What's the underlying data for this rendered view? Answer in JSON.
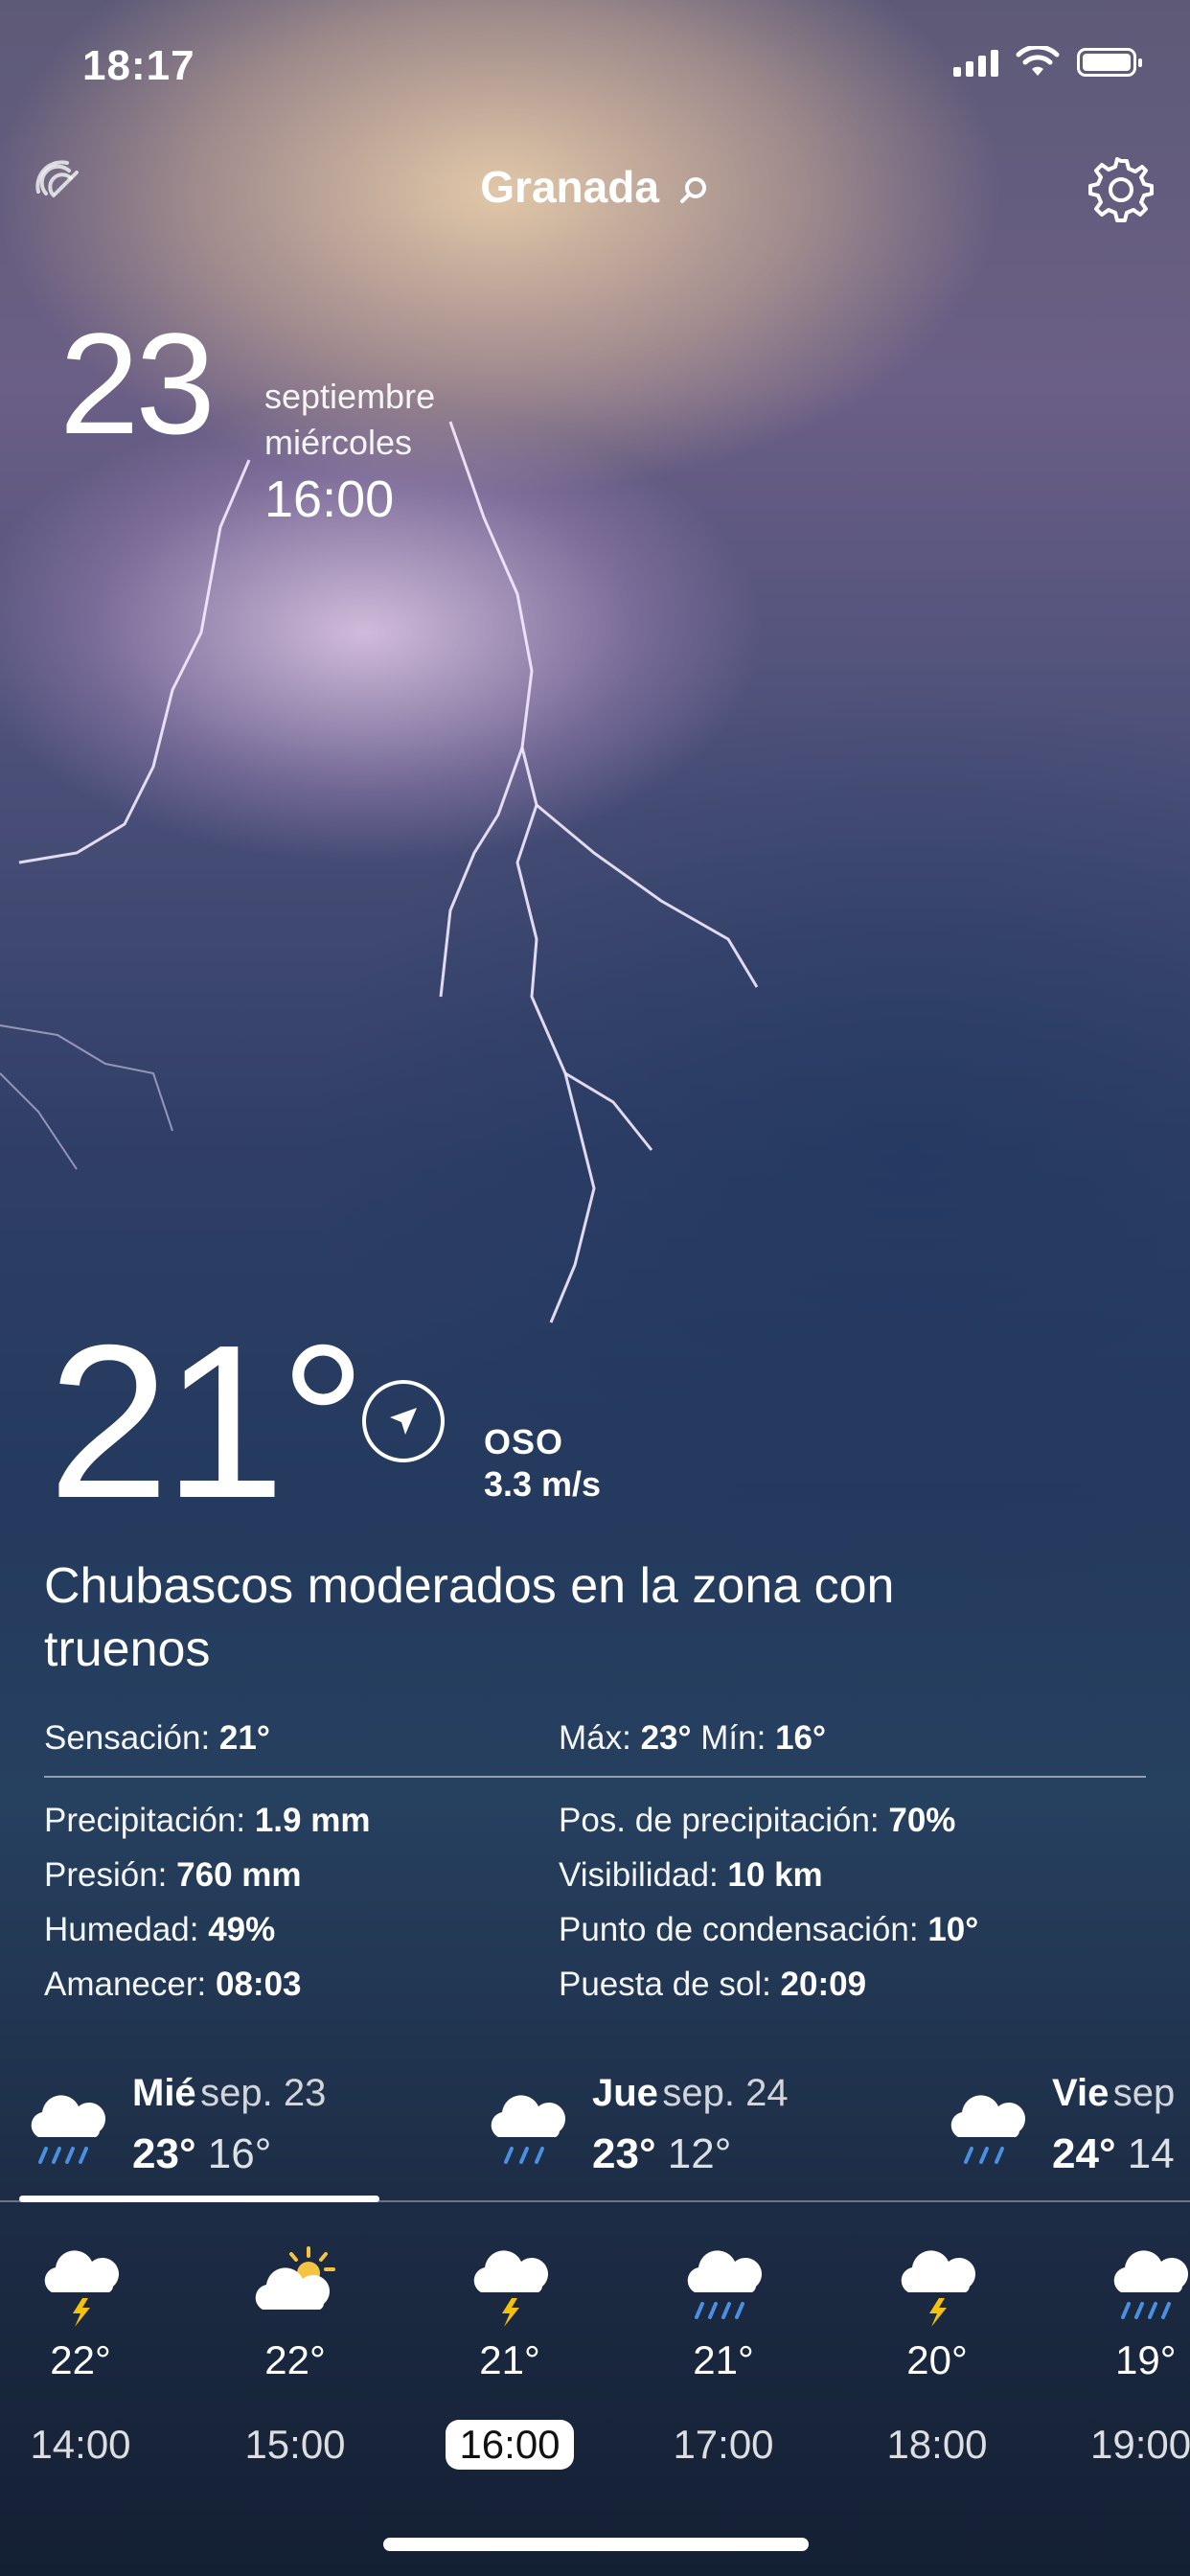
{
  "status_bar": {
    "time": "18:17",
    "icons": [
      "signal-icon",
      "wifi-icon",
      "battery-icon"
    ]
  },
  "header": {
    "city": "Granada",
    "left_icon": "radar-icon",
    "search_icon": "search-icon",
    "right_icon": "gear-icon"
  },
  "date": {
    "day": "23",
    "month": "septiembre",
    "weekday": "miércoles",
    "time": "16:00"
  },
  "current": {
    "temperature": "21°",
    "wind_direction": "OSO",
    "wind_speed": "3.3 m/s",
    "condition": "Chubascos moderados en la zona con truenos"
  },
  "details": {
    "feels_label": "Sensación:",
    "feels_value": "21°",
    "max_label": "Máx:",
    "max_value": "23°",
    "min_label": "Mín:",
    "min_value": "16°",
    "precip_label": "Precipitación:",
    "precip_value": "1.9 mm",
    "precip_prob_label": "Pos. de precipitación:",
    "precip_prob_value": "70%",
    "pressure_label": "Presión:",
    "pressure_value": "760 mm",
    "visibility_label": "Visibilidad:",
    "visibility_value": "10 km",
    "humidity_label": "Humedad:",
    "humidity_value": "49%",
    "dewpoint_label": "Punto de condensación:",
    "dewpoint_value": "10°",
    "sunrise_label": "Amanecer:",
    "sunrise_value": "08:03",
    "sunset_label": "Puesta de sol:",
    "sunset_value": "20:09"
  },
  "days": [
    {
      "name": "Mié",
      "date": "sep. 23",
      "max": "23°",
      "min": "16°",
      "icon": "rain-cloud-icon"
    },
    {
      "name": "Jue",
      "date": "sep. 24",
      "max": "23°",
      "min": "12°",
      "icon": "rain-cloud-icon"
    },
    {
      "name": "Vie",
      "date": "sep",
      "max": "24°",
      "min": "14",
      "icon": "rain-cloud-icon"
    }
  ],
  "hours": [
    {
      "temp": "22°",
      "time": "14:00",
      "icon": "thunder-cloud-icon"
    },
    {
      "temp": "22°",
      "time": "15:00",
      "icon": "sun-cloud-icon"
    },
    {
      "temp": "21°",
      "time": "16:00",
      "icon": "thunder-cloud-icon",
      "selected": true
    },
    {
      "temp": "21°",
      "time": "17:00",
      "icon": "rain-cloud-icon"
    },
    {
      "temp": "20°",
      "time": "18:00",
      "icon": "thunder-cloud-icon"
    },
    {
      "temp": "19°",
      "time": "19:00",
      "icon": "rain-cloud-icon"
    }
  ],
  "colors": {
    "lightning": "#f3e8ff",
    "sun": "#f5c542",
    "bolt": "#f4c20d",
    "rain": "#4a90e2"
  }
}
